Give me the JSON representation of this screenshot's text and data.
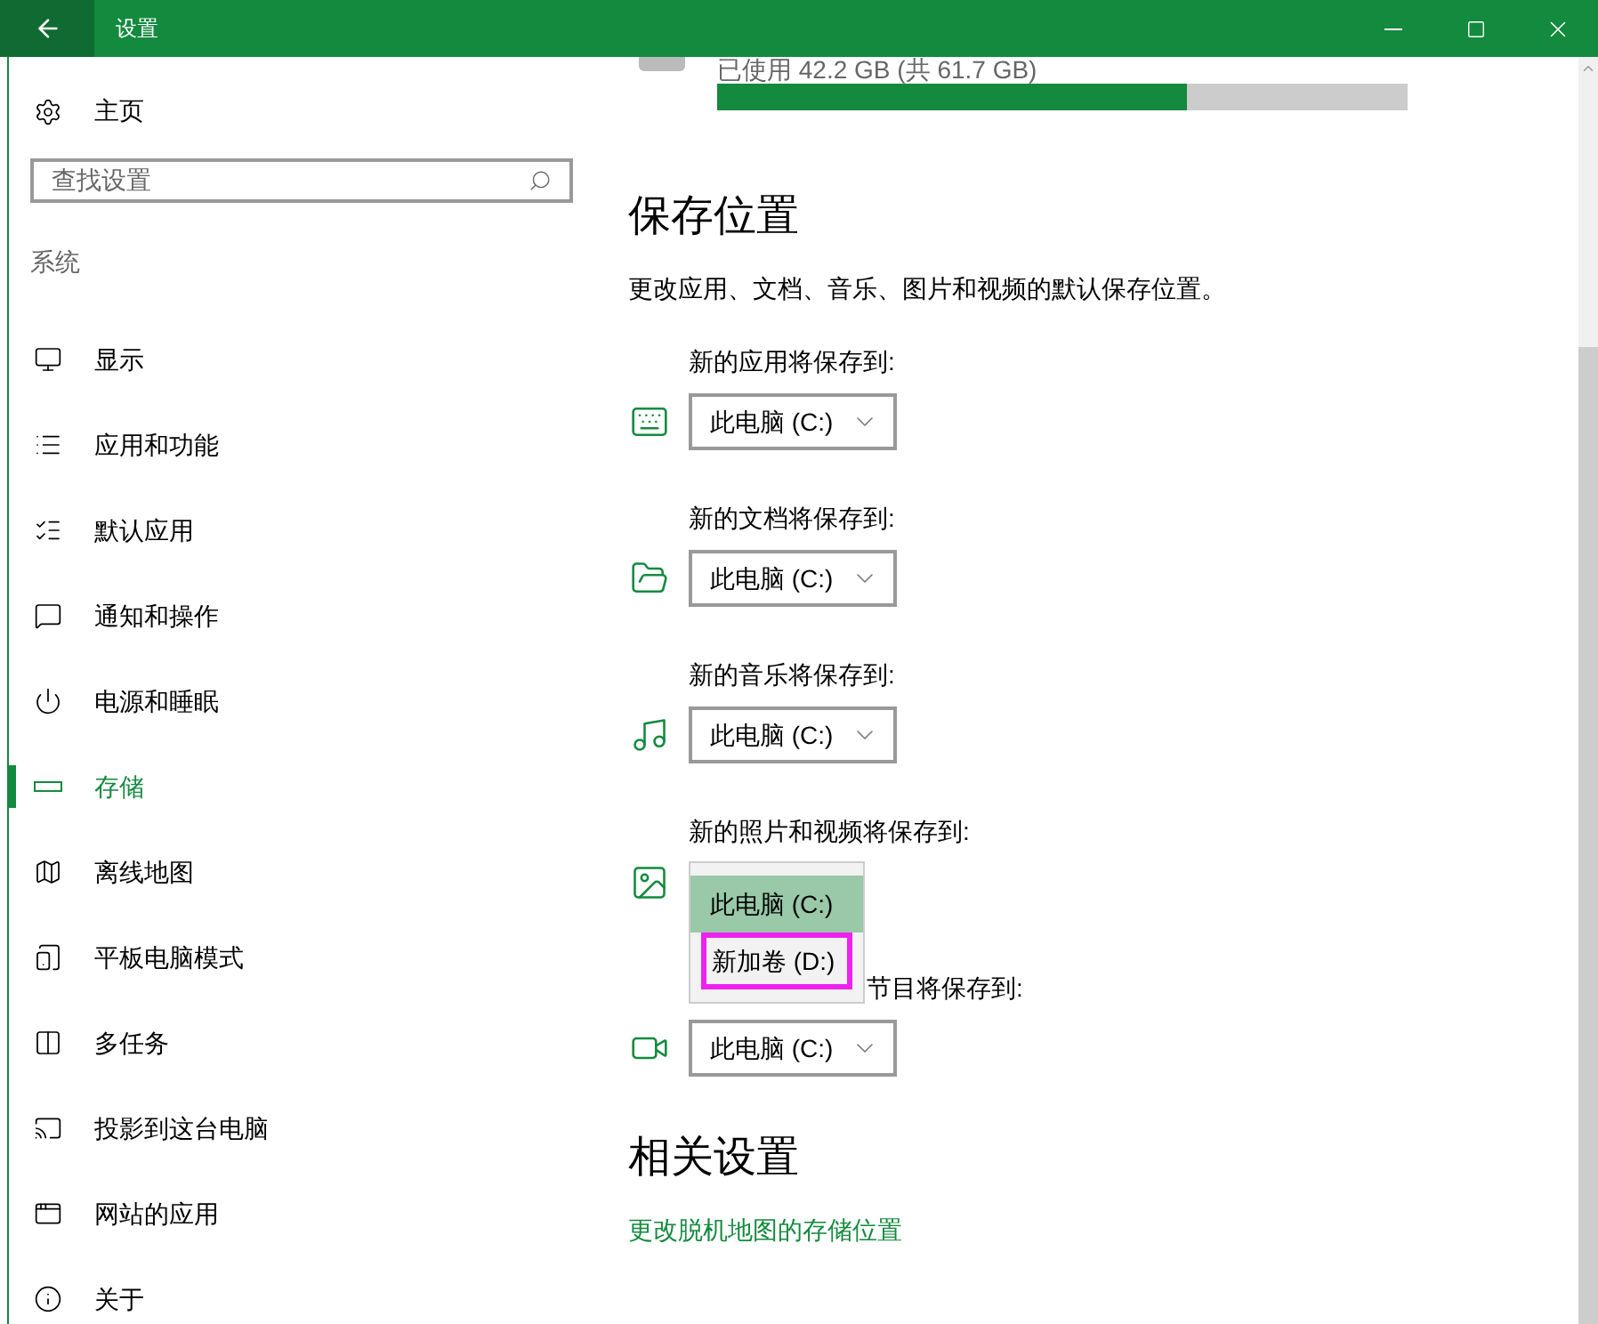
{
  "window": {
    "title": "设置"
  },
  "sidebar": {
    "home": "主页",
    "search": {
      "placeholder": "查找设置"
    },
    "section": "系统",
    "items": [
      {
        "label": "显示",
        "selected": false
      },
      {
        "label": "应用和功能",
        "selected": false
      },
      {
        "label": "默认应用",
        "selected": false
      },
      {
        "label": "通知和操作",
        "selected": false
      },
      {
        "label": "电源和睡眠",
        "selected": false
      },
      {
        "label": "存储",
        "selected": true
      },
      {
        "label": "离线地图",
        "selected": false
      },
      {
        "label": "平板电脑模式",
        "selected": false
      },
      {
        "label": "多任务",
        "selected": false
      },
      {
        "label": "投影到这台电脑",
        "selected": false
      },
      {
        "label": "网站的应用",
        "selected": false
      },
      {
        "label": "关于",
        "selected": false
      }
    ]
  },
  "storage": {
    "usage": "已使用 42.2 GB (共 61.7 GB)",
    "level": 0.68
  },
  "save_locations": {
    "heading": "保存位置",
    "description": "更改应用、文档、音乐、图片和视频的默认保存位置。",
    "rows": [
      {
        "label": "新的应用将保存到:",
        "value": "此电脑 (C:)",
        "open": false
      },
      {
        "label": "新的文档将保存到:",
        "value": "此电脑 (C:)",
        "open": false
      },
      {
        "label": "新的音乐将保存到:",
        "value": "此电脑 (C:)",
        "open": false
      },
      {
        "label": "新的照片和视频将保存到:",
        "open": true,
        "options": [
          {
            "label": "此电脑 (C:)",
            "selected": true,
            "outlined": false
          },
          {
            "label": "新加卷 (D:)",
            "selected": false,
            "outlined": true
          }
        ]
      },
      {
        "label": "节目将保存到:",
        "value": "此电脑 (C:)",
        "open": false
      }
    ]
  },
  "related": {
    "heading": "相关设置",
    "link": "更改脱机地图的存储位置"
  }
}
